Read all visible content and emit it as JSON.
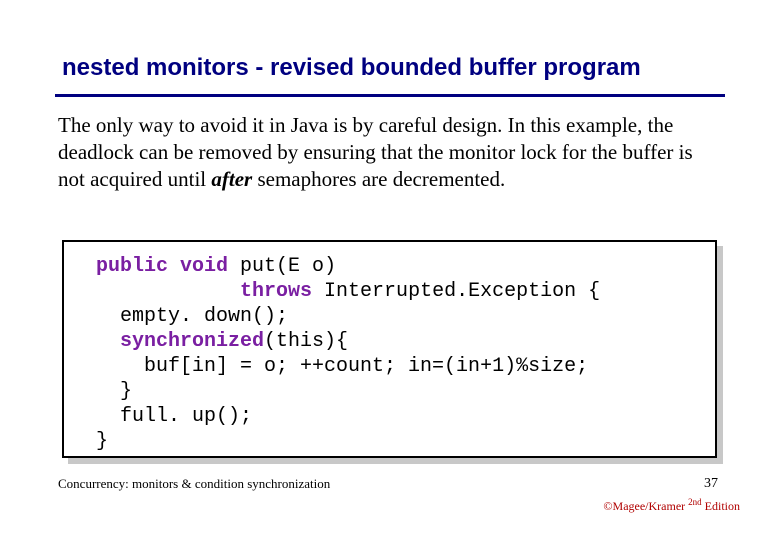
{
  "title": "nested monitors - revised bounded buffer program",
  "body": {
    "part1": "The only way to avoid it in Java is by careful design. In this example, the deadlock can be removed by ensuring that the monitor lock for the buffer is not acquired until ",
    "after": "after",
    "part2": " semaphores are decremented."
  },
  "code": {
    "kw_public": "public",
    "kw_void": "void",
    "sig1": " put(E o)",
    "kw_throws": "throws",
    "sig2": " Interrupted.Exception {",
    "line3": "  empty. down();",
    "kw_sync": "synchronized",
    "sync_tail": "(this){",
    "line5": "    buf[in] = o; ++count; in=(in+1)%size;",
    "line6": "  }",
    "line7": "  full. up();",
    "line8": "}"
  },
  "footer": {
    "left": "Concurrency: monitors & condition synchronization",
    "pagenum": "37",
    "credit_prefix": "©Magee/Kramer ",
    "credit_sup": "2nd",
    "credit_suffix": " Edition"
  }
}
